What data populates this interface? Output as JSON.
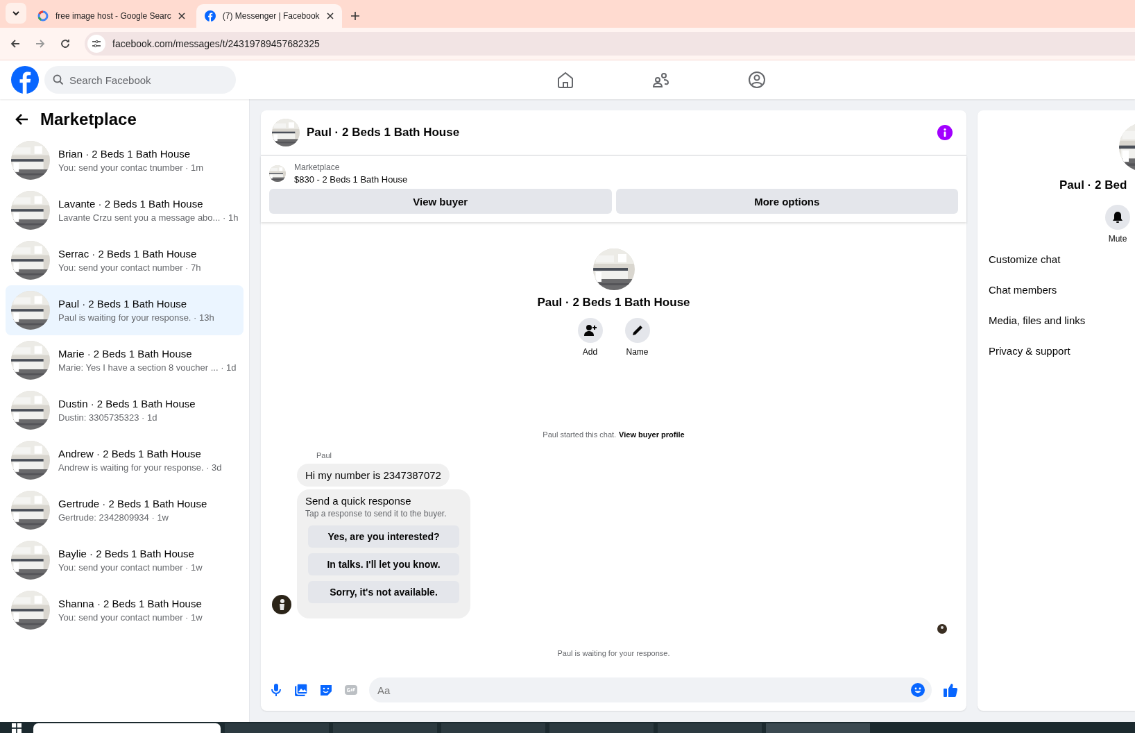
{
  "browser": {
    "tabs": [
      {
        "title": "free image host - Google Searc",
        "selected": false
      },
      {
        "title": "(7) Messenger | Facebook",
        "selected": true
      }
    ],
    "url": "facebook.com/messages/t/24319789457682325"
  },
  "header": {
    "search_placeholder": "Search Facebook"
  },
  "sidebar": {
    "title": "Marketplace",
    "conversations": [
      {
        "name": "Brian · 2 Beds 1 Bath House",
        "snippet": "You: send your contac tnumber · 1m",
        "selected": false
      },
      {
        "name": "Lavante · 2 Beds 1 Bath House",
        "snippet": "Lavante Crzu sent you a message abo...  · 1h",
        "selected": false
      },
      {
        "name": "Serrac · 2 Beds 1 Bath House",
        "snippet": "You: send your contact number · 7h",
        "selected": false
      },
      {
        "name": "Paul · 2 Beds 1 Bath House",
        "snippet": "Paul is waiting for your response. · 13h",
        "selected": true
      },
      {
        "name": "Marie · 2 Beds 1 Bath House",
        "snippet": "Marie: Yes I have a section 8 voucher ...  · 1d",
        "selected": false
      },
      {
        "name": "Dustin · 2 Beds 1 Bath House",
        "snippet": "Dustin: 3305735323 · 1d",
        "selected": false
      },
      {
        "name": "Andrew · 2 Beds 1 Bath House",
        "snippet": "Andrew is waiting for your response. · 3d",
        "selected": false
      },
      {
        "name": "Gertrude · 2 Beds 1 Bath House",
        "snippet": "Gertrude: 2342809934 · 1w",
        "selected": false
      },
      {
        "name": "Baylie · 2 Beds 1 Bath House",
        "snippet": "You: send your contact number · 1w",
        "selected": false
      },
      {
        "name": "Shanna · 2 Beds 1 Bath House",
        "snippet": "You: send your contact number · 1w",
        "selected": false
      }
    ]
  },
  "chat": {
    "title": "Paul · 2 Beds 1 Bath House",
    "listing": {
      "label": "Marketplace",
      "detail": "$830 - 2 Beds 1 Bath House"
    },
    "buttons": [
      "View buyer",
      "More options"
    ],
    "profile": {
      "name": "Paul · 2 Beds 1 Bath House",
      "actions": [
        {
          "kind": "add",
          "label": "Add"
        },
        {
          "kind": "name",
          "label": "Name"
        }
      ]
    },
    "started_text": "Paul started this chat.",
    "profile_link": "View buyer profile",
    "sender": "Paul",
    "message": "Hi my number is 2347387072",
    "quick_response": {
      "title": "Send a quick response",
      "hint": "Tap a response to send it to the buyer.",
      "options": [
        "Yes, are you interested?",
        "In talks. I'll let you know.",
        "Sorry, it's not available."
      ]
    },
    "status": "Paul is waiting for your response.",
    "composer_placeholder": "Aa"
  },
  "details": {
    "name": "Paul · 2 Bed",
    "action": "Mute",
    "menu": [
      "Customize chat",
      "Chat members",
      "Media, files and links",
      "Privacy & support"
    ]
  }
}
